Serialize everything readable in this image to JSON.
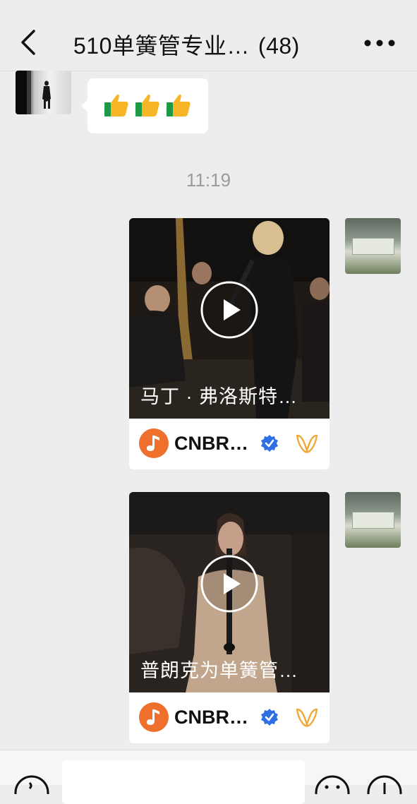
{
  "header": {
    "back_icon": "chevron-left-icon",
    "title": "510单簧管专业…",
    "member_count": "(48)",
    "more_icon": "more-horizontal-icon"
  },
  "messages": [
    {
      "type": "text",
      "side": "left",
      "content": "👍👍👍"
    },
    {
      "type": "time",
      "text": "11:19"
    },
    {
      "type": "video",
      "side": "right",
      "video_title": "马丁 · 弗洛斯特…",
      "channel": "CNBR…",
      "verified_icon": "verified-badge-icon",
      "platform_icon": "channels-logo-icon",
      "play_icon": "play-icon"
    },
    {
      "type": "video",
      "side": "right",
      "video_title": "普朗克为单簧管…",
      "channel": "CNBR…",
      "verified_icon": "verified-badge-icon",
      "platform_icon": "channels-logo-icon",
      "play_icon": "play-icon"
    }
  ],
  "bottom_bar": {
    "voice_icon": "voice-icon",
    "emoji_icon": "emoji-icon",
    "plus_icon": "plus-icon",
    "input_value": ""
  },
  "colors": {
    "background": "#ededed",
    "time_text": "#9b9b9b",
    "verified": "#2f6fe4",
    "app_logo": "#ef6f2c"
  }
}
